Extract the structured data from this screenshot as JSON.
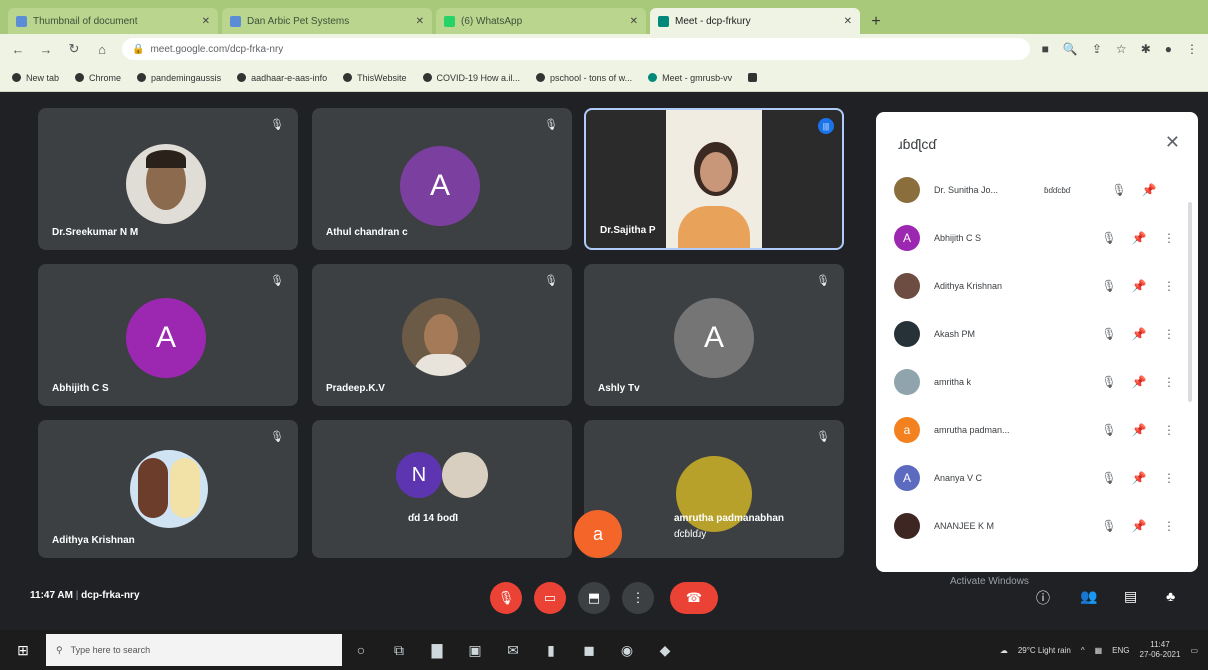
{
  "browser": {
    "tabs": [
      {
        "title": "Thumbnail of document"
      },
      {
        "title": "Dan Arbic Pet Systems"
      },
      {
        "title": "(6) WhatsApp"
      },
      {
        "title": "Meet - dcp-frkury"
      }
    ],
    "url": "meet.google.com/dcp-frka-nry",
    "bookmarks": [
      "New tab",
      "Chrome",
      "pandemingaussis",
      "aadhaar-e-aas-info",
      "ThisWebsite",
      "COVID-19 How a.il...",
      "pschool - tons of w...",
      "Meet - gmrusb-vv"
    ]
  },
  "tiles": [
    {
      "name": "Dr.Sreekumar N M",
      "letter": "",
      "color": "#6b5a45"
    },
    {
      "name": "Athul chandran c",
      "letter": "A",
      "color": "#7b3fa0"
    },
    {
      "name": "Dr.Sajitha P",
      "letter": "",
      "color": ""
    },
    {
      "name": "Abhijith C S",
      "letter": "A",
      "color": "#9c27b0"
    },
    {
      "name": "Pradeep.K.V",
      "letter": "",
      "color": "#5a4a3a"
    },
    {
      "name": "Ashly Tv",
      "letter": "A",
      "color": "#757575"
    },
    {
      "name": "Adithya Krishnan",
      "letter": "",
      "color": "#7da6c8"
    },
    {
      "name": "ɗd 14 ɓoɗI",
      "letter": "N",
      "color": "#5e35b1"
    },
    {
      "name": "amrutha padmanabhan",
      "subname": "ɗcɓlɗɹy",
      "letter": "",
      "color": "#b7a12a"
    }
  ],
  "panel": {
    "title": "ɹɓɗɭcɗ",
    "participants": [
      {
        "name": "Dr. Sunitha Jo...",
        "tag": "ɓɗɗcɓɗ",
        "letter": "",
        "color": "#8a6e3b"
      },
      {
        "name": "Abhijith C S",
        "letter": "A",
        "color": "#9c27b0"
      },
      {
        "name": "Adithya Krishnan",
        "letter": "",
        "color": "#6d4c41"
      },
      {
        "name": "Akash PM",
        "letter": "",
        "color": "#263238"
      },
      {
        "name": "amritha k",
        "letter": "",
        "color": "#90a4ae"
      },
      {
        "name": "amrutha padman...",
        "letter": "a",
        "color": "#f4811f"
      },
      {
        "name": "Ananya V C",
        "letter": "A",
        "color": "#5c6bc0"
      },
      {
        "name": "ANANJEE K M",
        "letter": "",
        "color": "#3e2723"
      }
    ]
  },
  "floating_avatar": {
    "letter": "a",
    "color": "#f4652a"
  },
  "bottombar": {
    "time": "11:47 AM",
    "separator": "|",
    "code": "dcp-frka-nry",
    "activate": "Activate Windows"
  },
  "taskbar": {
    "search_placeholder": "Type here to search",
    "weather": "29°C Light rain",
    "lang": "ENG",
    "clock_time": "11:47",
    "clock_date": "27-06-2021"
  }
}
